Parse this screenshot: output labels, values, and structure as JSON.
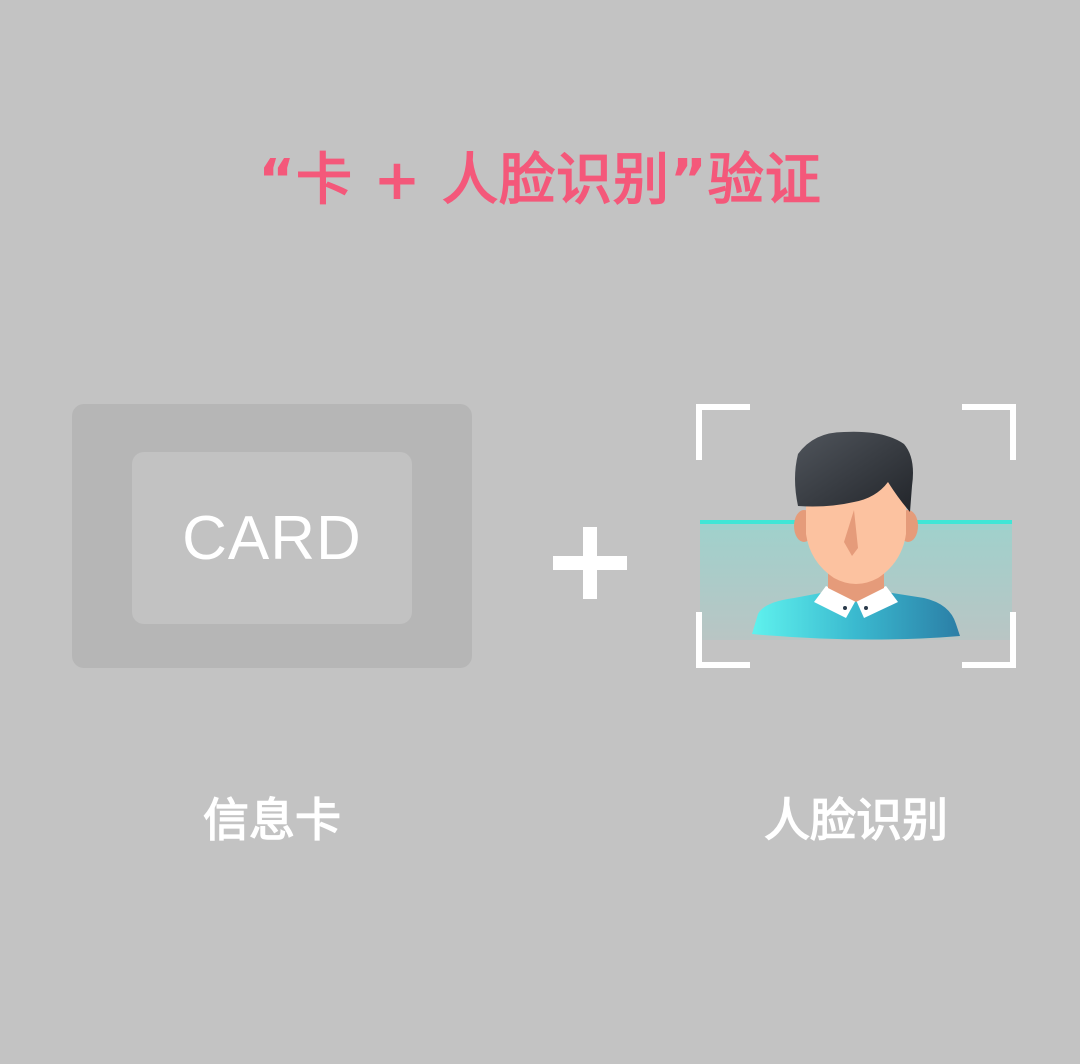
{
  "title": "“卡 + 人脸识别”验证",
  "card": {
    "text": "CARD",
    "label": "信息卡"
  },
  "plus_icon": "plus-icon",
  "face": {
    "label": "人脸识别",
    "icon": "face-scan-icon"
  },
  "colors": {
    "background": "#c3c3c3",
    "accent": "#f4587a",
    "scan_line": "#3fe6d6"
  }
}
